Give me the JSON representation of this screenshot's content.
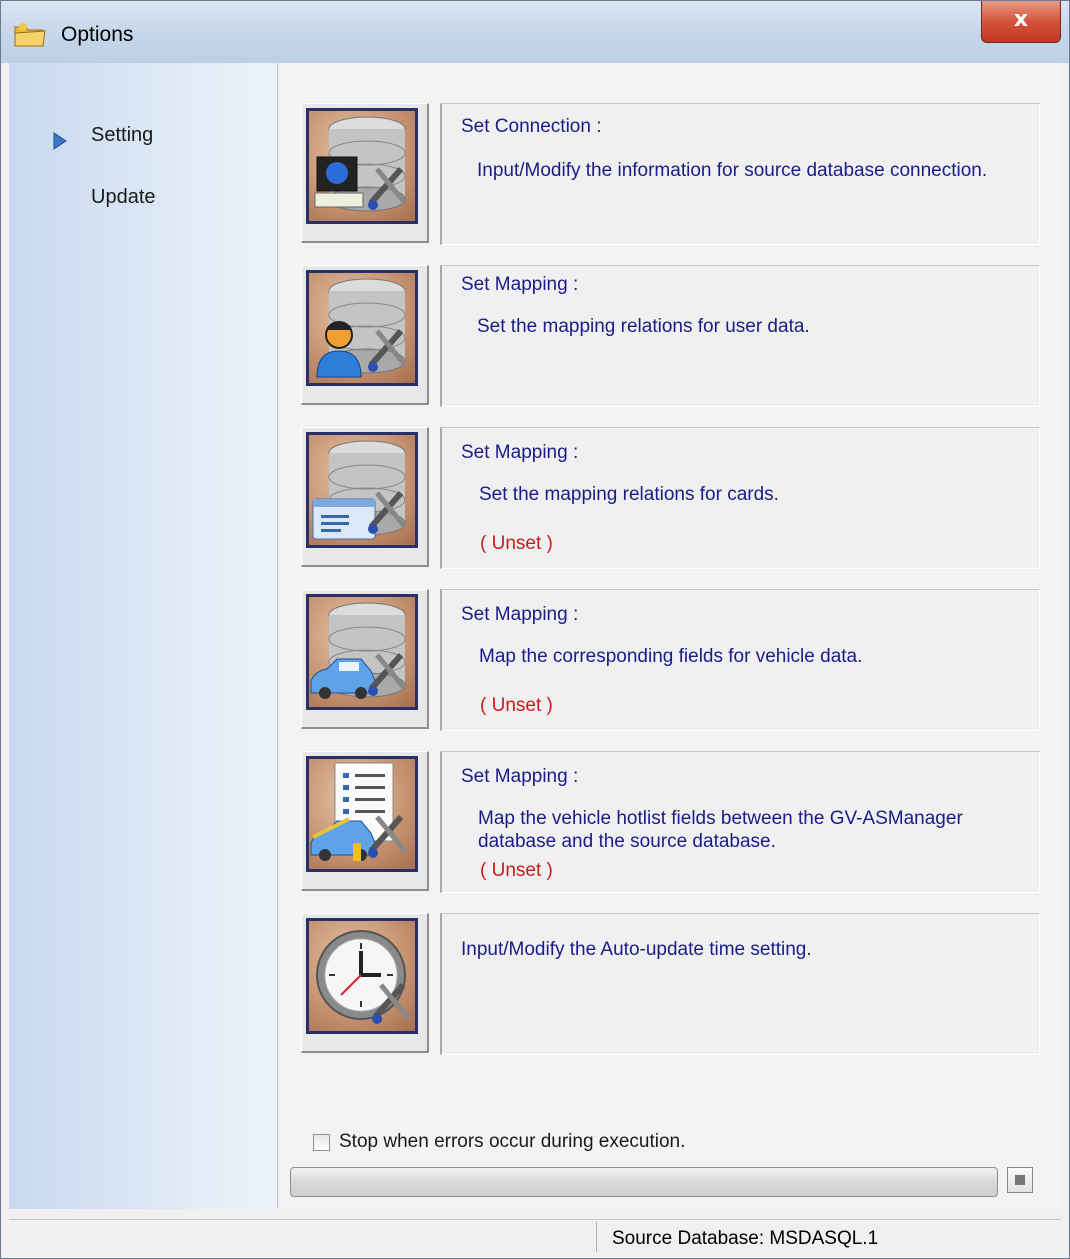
{
  "window": {
    "title": "Options",
    "close_glyph": "x",
    "title_icon": "folder-icon"
  },
  "sidebar": {
    "items": [
      {
        "label": "Setting",
        "selected": true
      },
      {
        "label": "Update",
        "selected": false
      }
    ]
  },
  "options": [
    {
      "icon": "database-computer-tools-icon",
      "title": "Set Connection :",
      "description": "Input/Modify the information for source database connection.",
      "status": ""
    },
    {
      "icon": "database-user-tools-icon",
      "title": "Set Mapping :",
      "description": "Set the mapping relations for user data.",
      "status": ""
    },
    {
      "icon": "database-card-tools-icon",
      "title": "Set Mapping :",
      "description": "Set the mapping relations for cards.",
      "status": "( Unset )"
    },
    {
      "icon": "database-vehicle-tools-icon",
      "title": "Set Mapping :",
      "description": "Map the corresponding fields for vehicle data.",
      "status": "( Unset )"
    },
    {
      "icon": "hotlist-vehicle-tools-icon",
      "title": "Set Mapping :",
      "description": "Map the vehicle hotlist fields between the GV-ASManager database and the source database.",
      "status": "( Unset )"
    },
    {
      "icon": "clock-tools-icon",
      "title": "",
      "description": "Input/Modify the Auto-update time setting.",
      "status": ""
    }
  ],
  "footer": {
    "checkbox_label": "Stop when errors occur during execution.",
    "checkbox_checked": false,
    "progress": 0
  },
  "statusbar": {
    "text": "Source Database: MSDASQL.1"
  },
  "colors": {
    "description_text": "#1b1b8a",
    "unset_text": "#cc1a1a",
    "icon_border": "#2a2f6a"
  }
}
